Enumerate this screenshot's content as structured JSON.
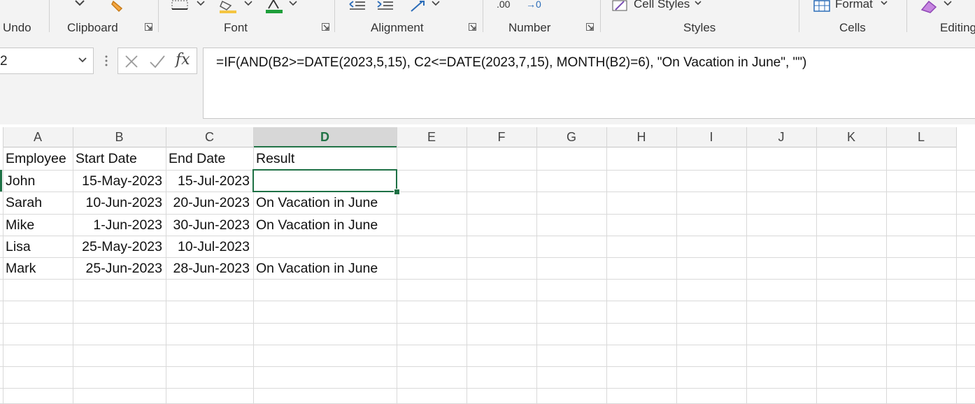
{
  "ribbon": {
    "groups": {
      "undo": "Undo",
      "clipboard": "Clipboard",
      "font": "Font",
      "alignment": "Alignment",
      "number": "Number",
      "styles": "Styles",
      "cells": "Cells",
      "editing": "Editing"
    },
    "cell_styles_label": "Cell Styles",
    "format_label": "Format",
    "decimal_label": ".00",
    "decimal_label2": "→0",
    "colors": {
      "font_color": "#1e9e3a",
      "fill_color": "#f4c542",
      "accent": "#217346"
    }
  },
  "formula_bar": {
    "name_box": "2",
    "formula": "=IF(AND(B2>=DATE(2023,5,15), C2<=DATE(2023,7,15), MONTH(B2)=6), \"On Vacation in June\", \"\")",
    "fx_label": "fx"
  },
  "sheet": {
    "columns": [
      "A",
      "B",
      "C",
      "D",
      "E",
      "F",
      "G",
      "H",
      "I",
      "J",
      "K",
      "L"
    ],
    "active_column": "D",
    "rows": [
      [
        "Employee",
        "Start Date",
        "End Date",
        "Result"
      ],
      [
        "John",
        "15-May-2023",
        "15-Jul-2023",
        ""
      ],
      [
        "Sarah",
        "10-Jun-2023",
        "20-Jun-2023",
        "On Vacation in June"
      ],
      [
        "Mike",
        "1-Jun-2023",
        "30-Jun-2023",
        "On Vacation in June"
      ],
      [
        "Lisa",
        "25-May-2023",
        "10-Jul-2023",
        ""
      ],
      [
        "Mark",
        "25-Jun-2023",
        "28-Jun-2023",
        "On Vacation in June"
      ]
    ]
  }
}
